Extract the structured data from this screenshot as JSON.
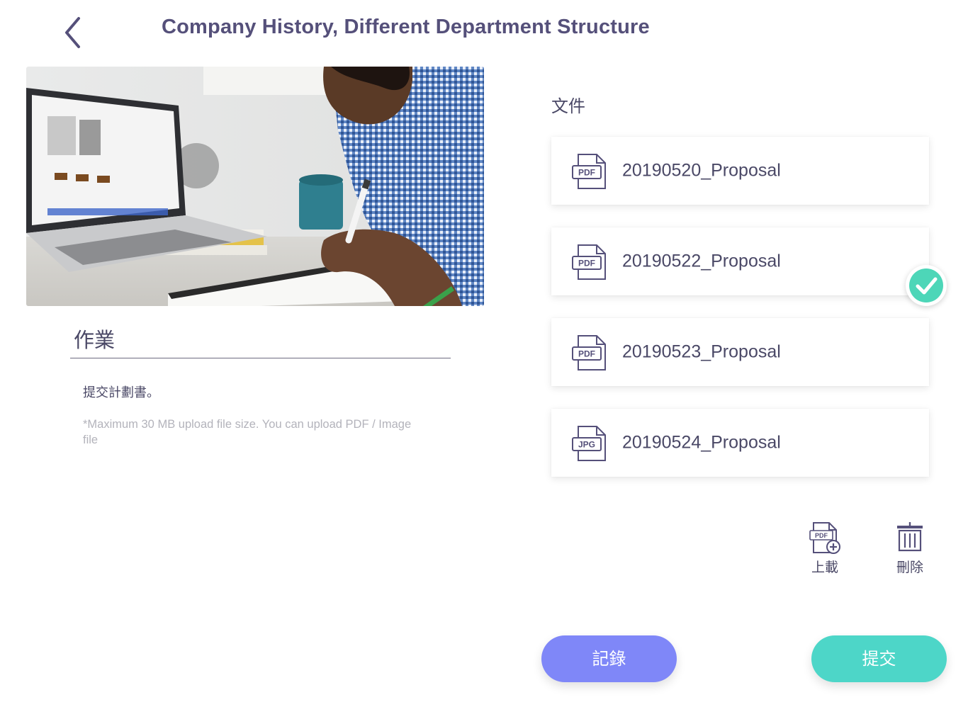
{
  "header": {
    "title": "Company History, Different Department Structure",
    "back_icon": "chevron-left-icon"
  },
  "assignment": {
    "section_title": "作業",
    "description": "提交計劃書。",
    "hint": "*Maximum 30 MB upload file size. You can upload PDF / Image file"
  },
  "documents": {
    "label": "文件",
    "files": [
      {
        "name": "20190520_Proposal",
        "type": "PDF",
        "selected": false
      },
      {
        "name": "20190522_Proposal",
        "type": "PDF",
        "selected": true
      },
      {
        "name": "20190523_Proposal",
        "type": "PDF",
        "selected": false
      },
      {
        "name": "20190524_Proposal",
        "type": "JPG",
        "selected": false
      }
    ]
  },
  "tools": {
    "upload_label": "上載",
    "upload_icon_text": "PDF",
    "delete_label": "刪除"
  },
  "actions": {
    "record_label": "記錄",
    "submit_label": "提交"
  },
  "colors": {
    "title": "#55507a",
    "text": "#4a4866",
    "record_button": "#7f87f8",
    "submit_button": "#4dd6c8",
    "check": "#4dd6b8"
  }
}
